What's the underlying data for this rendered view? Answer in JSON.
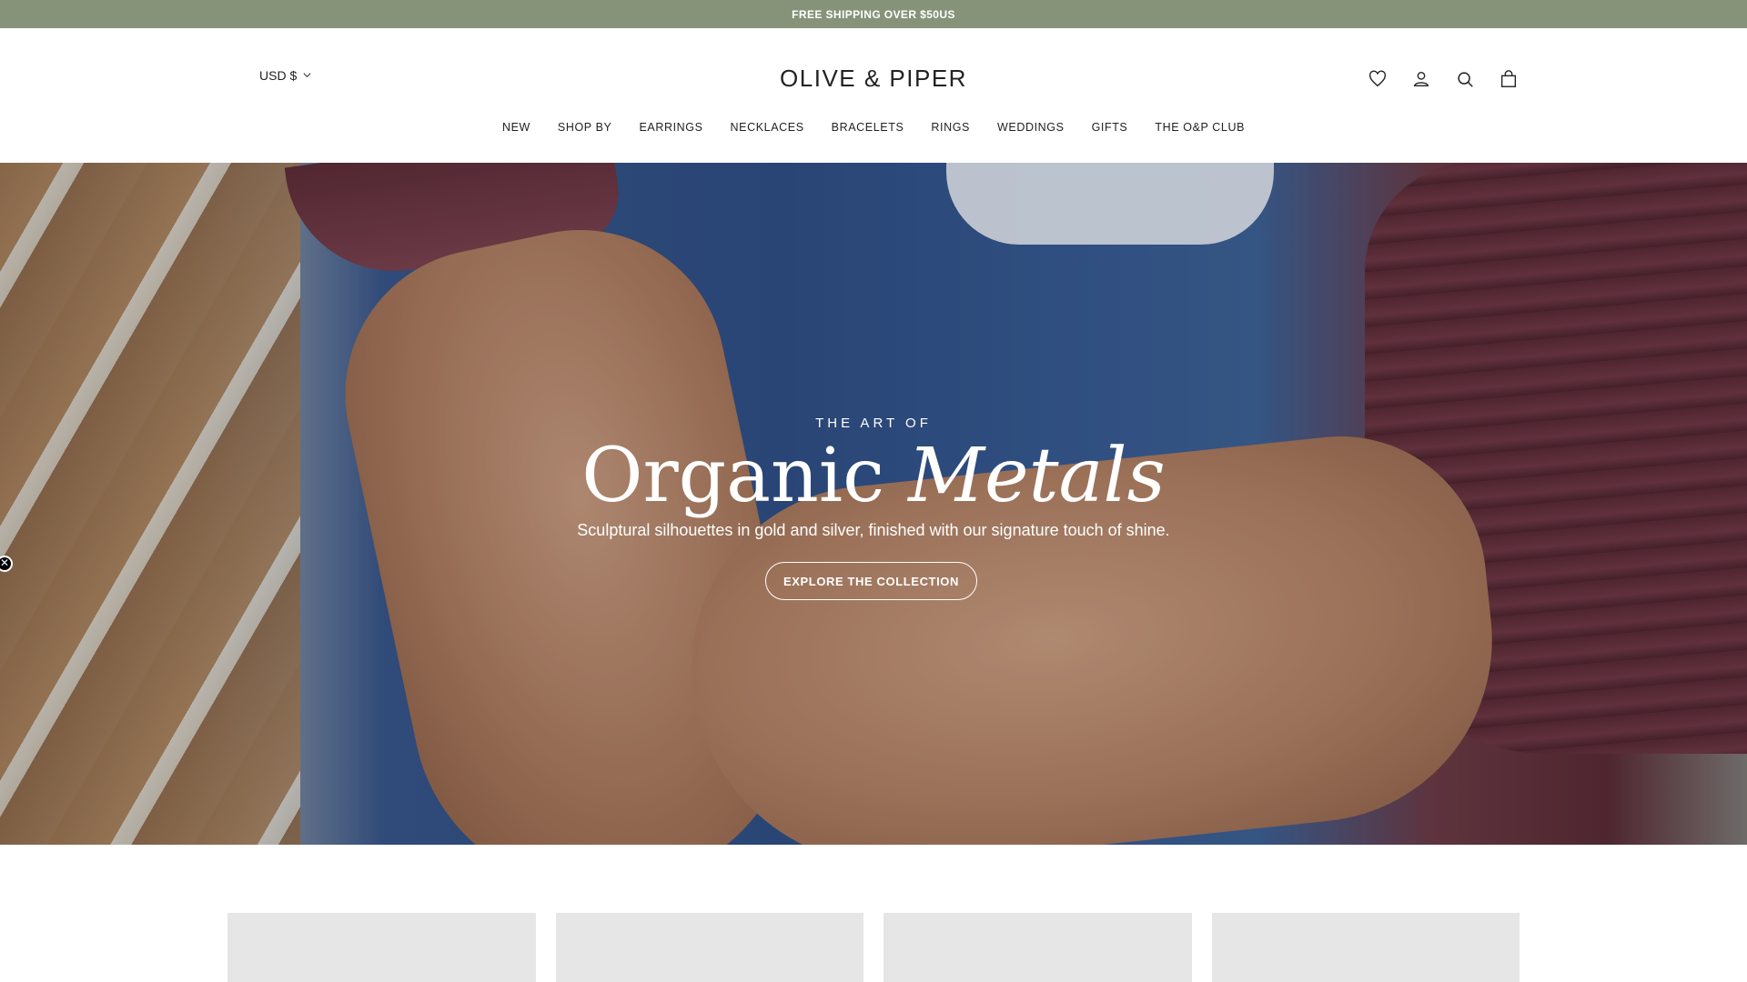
{
  "colors": {
    "announcement_bg": "#869379",
    "text": "#222222",
    "placeholder": "#e6e6e6"
  },
  "announcement": {
    "text": "FREE SHIPPING OVER $50US"
  },
  "header": {
    "currency": "USD $",
    "logo": "OLIVE & PIPER",
    "icons": [
      "heart-icon",
      "account-icon",
      "search-icon",
      "bag-icon"
    ]
  },
  "nav": {
    "items": [
      "NEW",
      "SHOP BY",
      "EARRINGS",
      "NECKLACES",
      "BRACELETS",
      "RINGS",
      "WEDDINGS",
      "GIFTS",
      "THE O&P CLUB"
    ]
  },
  "hero": {
    "eyebrow": "THE ART OF",
    "headline_regular": "Organic",
    "headline_italic": "Metals",
    "subline": "Sculptural silhouettes in gold and silver, finished with our signature touch of shine.",
    "cta": "EXPLORE THE COLLECTION"
  },
  "popup_close": {
    "glyph": "✕"
  }
}
